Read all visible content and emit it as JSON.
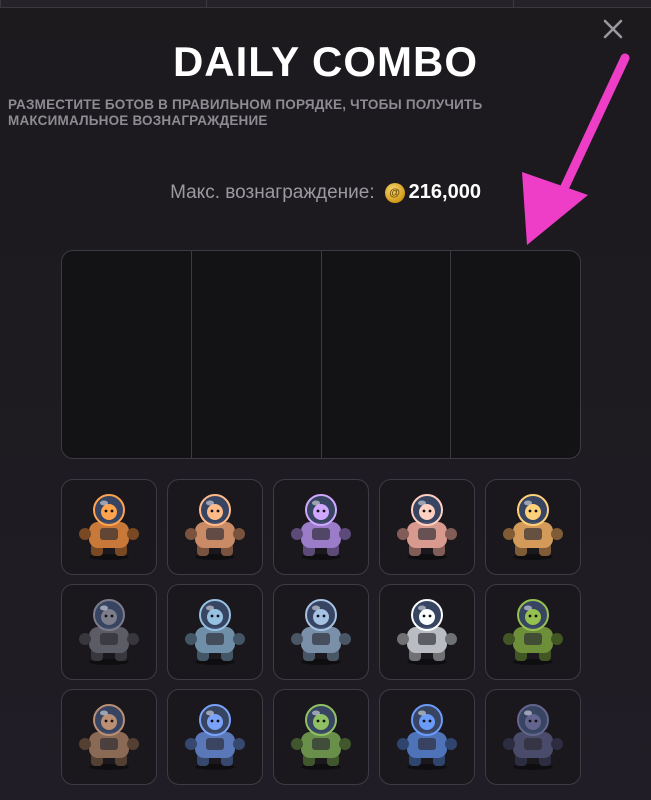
{
  "header": {
    "title": "DAILY COMBO",
    "subtitle": "РАЗМЕСТИТЕ БОТОВ В ПРАВИЛЬНОМ ПОРЯДКЕ, ЧТОБЫ ПОЛУЧИТЬ МАКСИМАЛЬНОЕ ВОЗНАГРАЖДЕНИЕ",
    "close_icon": "close-icon"
  },
  "reward": {
    "label": "Макс. вознаграждение:",
    "coin_icon": "coin-icon",
    "coin_glyph": "@",
    "value": "216,000"
  },
  "slots": [
    {
      "state": "empty"
    },
    {
      "state": "empty"
    },
    {
      "state": "empty"
    },
    {
      "state": "empty"
    }
  ],
  "bots": [
    {
      "icon": "astronaut-bot-orange-icon",
      "color": "#c8793a"
    },
    {
      "icon": "mech-bot-orange-icon",
      "color": "#c98a66"
    },
    {
      "icon": "mech-bot-purple-icon",
      "color": "#9a7cc9"
    },
    {
      "icon": "hamster-ball-bot-icon",
      "color": "#d89a8f"
    },
    {
      "icon": "shiba-explorer-bot-icon",
      "color": "#d49a5a"
    },
    {
      "icon": "cat-robot-icon",
      "color": "#5c5c66"
    },
    {
      "icon": "cactus-tank-bot-icon",
      "color": "#6f8fa8"
    },
    {
      "icon": "cactus-tank-bot-alt-icon",
      "color": "#7a8fa8"
    },
    {
      "icon": "flying-drone-bot-icon",
      "color": "#b9bcc2"
    },
    {
      "icon": "mantis-bot-icon",
      "color": "#6e8f3a"
    },
    {
      "icon": "spider-bot-icon",
      "color": "#8a6a55"
    },
    {
      "icon": "rocket-bot-blue-icon",
      "color": "#5a78b8"
    },
    {
      "icon": "astronaut-bot-green-icon",
      "color": "#6a8f4a"
    },
    {
      "icon": "astronaut-bot-blue-icon",
      "color": "#4f73b8"
    },
    {
      "icon": "panther-bot-icon",
      "color": "#4a4b6a"
    }
  ],
  "annotation": {
    "arrow_color": "#ee3ec8"
  }
}
